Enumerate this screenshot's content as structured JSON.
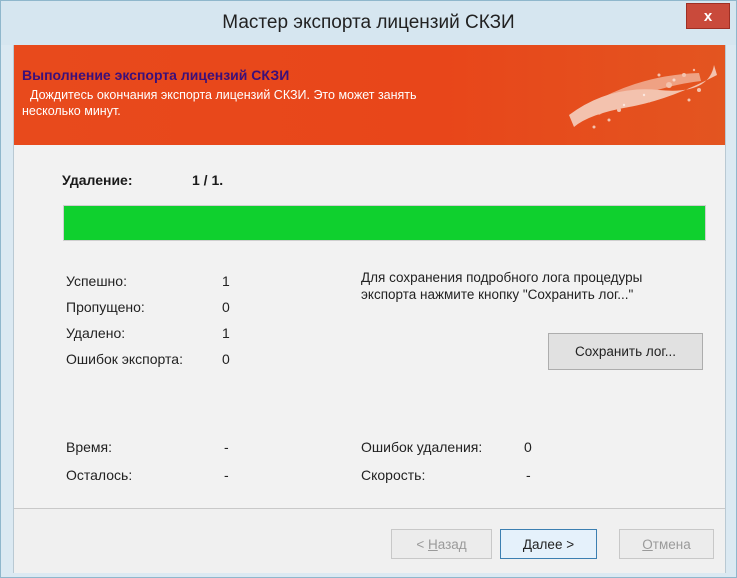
{
  "window": {
    "title": "Мастер экспорта лицензий СКЗИ",
    "close_label": "x"
  },
  "banner": {
    "title": "Выполнение экспорта лицензий СКЗИ",
    "subtitle_line1": "Дождитесь окончания экспорта лицензий СКЗИ. Это может занять",
    "subtitle_line2": "несколько минут."
  },
  "progress": {
    "label": "Удаление:",
    "value": "1 / 1.",
    "fraction": 1.0
  },
  "stats": {
    "success_label": "Успешно:",
    "success_value": "1",
    "skipped_label": "Пропущено:",
    "skipped_value": "0",
    "deleted_label": "Удалено:",
    "deleted_value": "1",
    "export_errors_label": "Ошибок экспорта:",
    "export_errors_value": "0",
    "time_label": "Время:",
    "time_value": "-",
    "remaining_label": "Осталось:",
    "remaining_value": "-",
    "delete_errors_label": "Ошибок удаления:",
    "delete_errors_value": "0",
    "speed_label": "Скорость:",
    "speed_value": "-"
  },
  "info": {
    "line1": "Для сохранения подробного лога процедуры",
    "line2": "экспорта нажмите кнопку \"Сохранить лог...\""
  },
  "buttons": {
    "save_log": "Сохранить лог...",
    "back_mnemonic": "Н",
    "back_rest": "азад",
    "back_prefix": "< ",
    "next_mnemonic": "Д",
    "next_rest": "алее >",
    "cancel_mnemonic": "О",
    "cancel_rest": "тмена"
  },
  "colors": {
    "banner": "#e8461a",
    "progress_fill": "#0fd02e",
    "banner_title": "#3b0f7a"
  }
}
